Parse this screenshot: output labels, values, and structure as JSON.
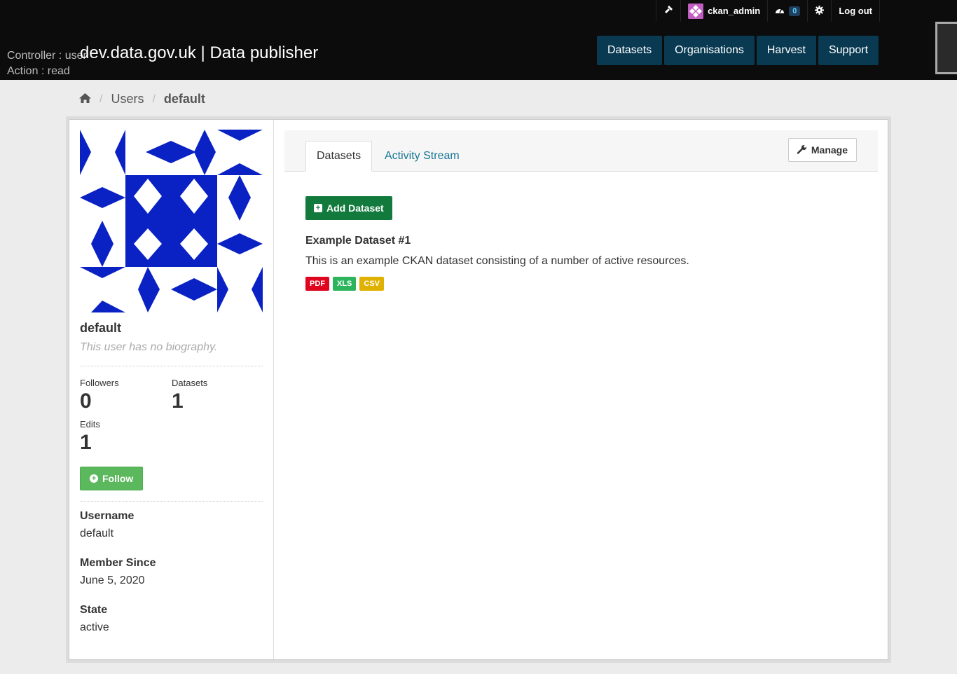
{
  "header": {
    "account": {
      "username": "ckan_admin",
      "dashboard_count": "0",
      "logout_label": "Log out"
    },
    "debug": {
      "controller": "Controller : user",
      "action": "Action : read"
    },
    "site_title": "dev.data.gov.uk | Data publisher",
    "nav": [
      "Datasets",
      "Organisations",
      "Harvest",
      "Support"
    ]
  },
  "breadcrumb": {
    "home_icon": "home-icon",
    "items": [
      "Users",
      "default"
    ]
  },
  "profile": {
    "heading": "default",
    "bio": "This user has no biography.",
    "stats": {
      "followers_label": "Followers",
      "followers_value": "0",
      "datasets_label": "Datasets",
      "datasets_value": "1",
      "edits_label": "Edits",
      "edits_value": "1"
    },
    "follow_label": "Follow",
    "info": {
      "username_label": "Username",
      "username_value": "default",
      "member_since_label": "Member Since",
      "member_since_value": "June 5, 2020",
      "state_label": "State",
      "state_value": "active"
    }
  },
  "content": {
    "tabs": [
      "Datasets",
      "Activity Stream"
    ],
    "manage_label": "Manage",
    "add_dataset_label": "Add Dataset",
    "dataset": {
      "title": "Example Dataset #1",
      "description": "This is an example CKAN dataset consisting of a number of active resources.",
      "formats": [
        {
          "label": "PDF",
          "color": "#e0051e"
        },
        {
          "label": "XLS",
          "color": "#2db55d"
        },
        {
          "label": "CSV",
          "color": "#dfb100"
        }
      ]
    }
  },
  "colors": {
    "header_bg": "#0c0c0c",
    "nav_btn": "#093a52",
    "identicon": "#0a22c4",
    "follow_green": "#5cb85c",
    "add_green": "#137a3d",
    "link": "#187794"
  }
}
